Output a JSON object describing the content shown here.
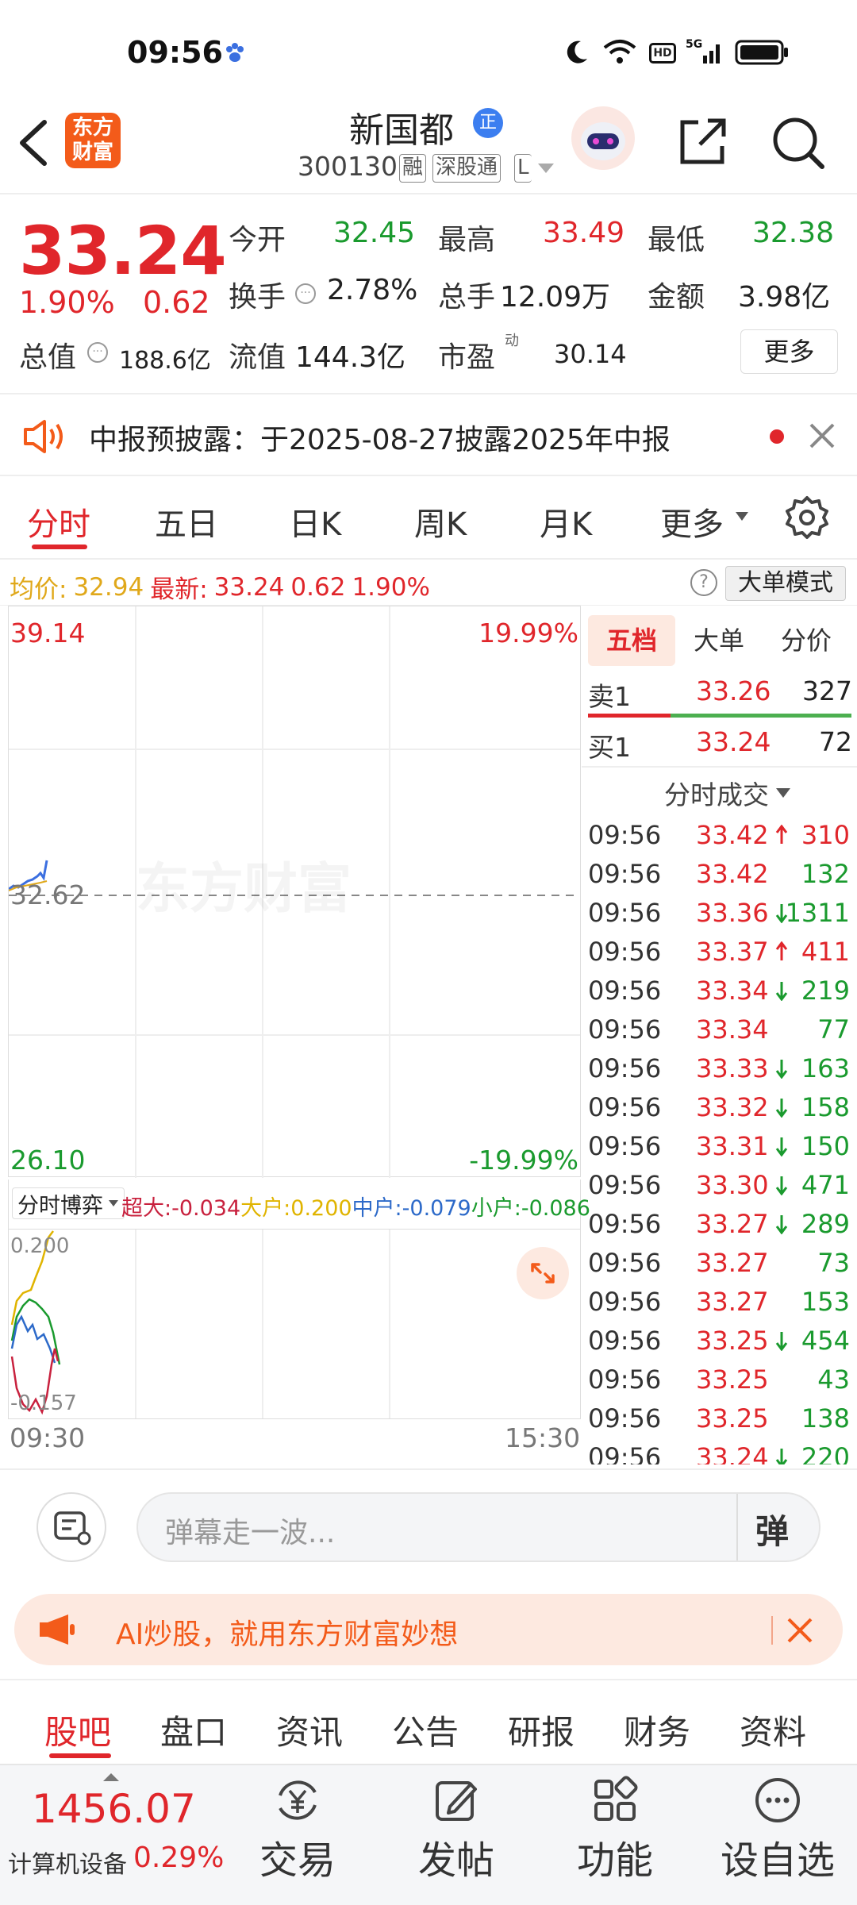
{
  "status_bar": {
    "time": "09:56"
  },
  "header": {
    "logo_line1": "东方",
    "logo_line2": "财富",
    "stock_name": "新国都",
    "badge": "正",
    "code": "300130",
    "tags": [
      "融",
      "深股通",
      "L"
    ]
  },
  "quote": {
    "price": "33.24",
    "change_pct": "1.90%",
    "change": "0.62",
    "open_label": "今开",
    "open": "32.45",
    "high_label": "最高",
    "high": "33.49",
    "low_label": "最低",
    "low": "32.38",
    "turnover_label": "换手",
    "turnover": "2.78%",
    "volume_label": "总手",
    "volume": "12.09万",
    "amount_label": "金额",
    "amount": "3.98亿",
    "mcap_label": "总值",
    "mcap": "188.6亿",
    "float_label": "流值",
    "float": "144.3亿",
    "pe_label": "市盈",
    "pe_sup": "动",
    "pe": "30.14",
    "more": "更多"
  },
  "notice": {
    "text": "中报预披露：于2025-08-27披露2025年中报"
  },
  "chart_tabs": [
    "分时",
    "五日",
    "日K",
    "周K",
    "月K",
    "更多"
  ],
  "info_line": {
    "avg_label": "均价:",
    "avg": "32.94",
    "latest_label": "最新:",
    "latest": "33.24",
    "latest_chg": "0.62",
    "latest_pct": "1.90%",
    "mode": "大单模式"
  },
  "chart": {
    "top_price": "39.14",
    "top_pct": "19.99%",
    "mid_price": "32.62",
    "bottom_price": "26.10",
    "bottom_pct": "-19.99%",
    "watermark": "东方财富",
    "flow_selector": "分时博弈",
    "super_label": "超大:",
    "super": "-0.034",
    "big_label": "大户:",
    "big": "0.200",
    "mid_label": "中户:",
    "mid": "-0.079",
    "small_label": "小户:",
    "small": "-0.086",
    "flow_top": "0.200",
    "flow_bottom": "-0.157",
    "time_start": "09:30",
    "time_end": "15:30"
  },
  "order_book": {
    "tabs": [
      "五档",
      "大单",
      "分价"
    ],
    "sell1_label": "卖1",
    "sell1_price": "33.26",
    "sell1_vol": "327",
    "buy1_label": "买1",
    "buy1_price": "33.24",
    "buy1_vol": "72",
    "ticks_title": "分时成交",
    "ticks": [
      {
        "t": "09:56",
        "p": "33.42",
        "dir": "up",
        "v": "310"
      },
      {
        "t": "09:56",
        "p": "33.42",
        "dir": "",
        "v": "132"
      },
      {
        "t": "09:56",
        "p": "33.36",
        "dir": "down",
        "v": "1311"
      },
      {
        "t": "09:56",
        "p": "33.37",
        "dir": "up",
        "v": "411"
      },
      {
        "t": "09:56",
        "p": "33.34",
        "dir": "down",
        "v": "219"
      },
      {
        "t": "09:56",
        "p": "33.34",
        "dir": "",
        "v": "77"
      },
      {
        "t": "09:56",
        "p": "33.33",
        "dir": "down",
        "v": "163"
      },
      {
        "t": "09:56",
        "p": "33.32",
        "dir": "down",
        "v": "158"
      },
      {
        "t": "09:56",
        "p": "33.31",
        "dir": "down",
        "v": "150"
      },
      {
        "t": "09:56",
        "p": "33.30",
        "dir": "down",
        "v": "471"
      },
      {
        "t": "09:56",
        "p": "33.27",
        "dir": "down",
        "v": "289"
      },
      {
        "t": "09:56",
        "p": "33.27",
        "dir": "",
        "v": "73"
      },
      {
        "t": "09:56",
        "p": "33.27",
        "dir": "",
        "v": "153"
      },
      {
        "t": "09:56",
        "p": "33.25",
        "dir": "down",
        "v": "454"
      },
      {
        "t": "09:56",
        "p": "33.25",
        "dir": "",
        "v": "43"
      },
      {
        "t": "09:56",
        "p": "33.25",
        "dir": "",
        "v": "138"
      },
      {
        "t": "09:56",
        "p": "33.24",
        "dir": "down",
        "v": "220"
      }
    ]
  },
  "danmaku": {
    "placeholder": "弹幕走一波...",
    "send": "弹"
  },
  "ai_banner": {
    "text": "AI炒股，就用东方财富妙想"
  },
  "forum_tabs": [
    "股吧",
    "盘口",
    "资讯",
    "公告",
    "研报",
    "财务",
    "资料"
  ],
  "bottom_bar": {
    "index_value": "1456.07",
    "index_name": "计算机设备",
    "index_pct": "0.29%",
    "items": [
      "交易",
      "发帖",
      "功能",
      "设自选"
    ]
  }
}
